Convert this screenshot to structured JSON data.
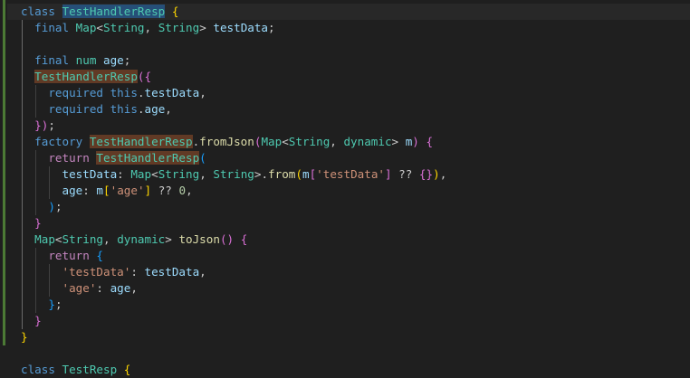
{
  "colors": {
    "background": "#1f1f1f",
    "current_line": "#282828",
    "git_gutter": "#4c7a35",
    "keyword": "#569cd6",
    "control": "#c586c0",
    "type": "#4ec9b0",
    "function": "#dcdcaa",
    "string": "#ce9178",
    "number": "#b5cea8",
    "variable": "#9cdcfe",
    "plain": "#cccccc",
    "brace_1": "#ffd700",
    "brace_2": "#da70d6",
    "brace_3": "#179fff",
    "match_highlight": "#613a25",
    "selection": "#264f78"
  },
  "code": {
    "language": "dart",
    "lines": [
      [
        [
          "keyword",
          "class "
        ],
        [
          "sel",
          "TestHandlerResp"
        ],
        [
          "plain",
          " "
        ],
        [
          "brace1",
          "{"
        ]
      ],
      [
        [
          "plain",
          "  "
        ],
        [
          "keyword",
          "final "
        ],
        [
          "type",
          "Map"
        ],
        [
          "plain",
          "<"
        ],
        [
          "type",
          "String"
        ],
        [
          "plain",
          ", "
        ],
        [
          "type",
          "String"
        ],
        [
          "plain",
          "> "
        ],
        [
          "var",
          "testData"
        ],
        [
          "plain",
          ";"
        ]
      ],
      [],
      [
        [
          "plain",
          "  "
        ],
        [
          "keyword",
          "final "
        ],
        [
          "type",
          "num "
        ],
        [
          "var",
          "age"
        ],
        [
          "plain",
          ";"
        ]
      ],
      [
        [
          "plain",
          "  "
        ],
        [
          "match",
          "TestHandlerResp"
        ],
        [
          "brace2",
          "({"
        ]
      ],
      [
        [
          "plain",
          "    "
        ],
        [
          "keyword",
          "required "
        ],
        [
          "keyword",
          "this"
        ],
        [
          "plain",
          "."
        ],
        [
          "var",
          "testData"
        ],
        [
          "plain",
          ","
        ]
      ],
      [
        [
          "plain",
          "    "
        ],
        [
          "keyword",
          "required "
        ],
        [
          "keyword",
          "this"
        ],
        [
          "plain",
          "."
        ],
        [
          "var",
          "age"
        ],
        [
          "plain",
          ","
        ]
      ],
      [
        [
          "plain",
          "  "
        ],
        [
          "brace2",
          "})"
        ],
        [
          "plain",
          ";"
        ]
      ],
      [
        [
          "plain",
          "  "
        ],
        [
          "keyword",
          "factory "
        ],
        [
          "match",
          "TestHandlerResp"
        ],
        [
          "plain",
          "."
        ],
        [
          "func",
          "fromJson"
        ],
        [
          "brace2",
          "("
        ],
        [
          "type",
          "Map"
        ],
        [
          "plain",
          "<"
        ],
        [
          "type",
          "String"
        ],
        [
          "plain",
          ", "
        ],
        [
          "type",
          "dynamic"
        ],
        [
          "plain",
          "> "
        ],
        [
          "var",
          "m"
        ],
        [
          "brace2",
          ")"
        ],
        [
          "plain",
          " "
        ],
        [
          "brace2",
          "{"
        ]
      ],
      [
        [
          "plain",
          "    "
        ],
        [
          "control",
          "return "
        ],
        [
          "match",
          "TestHandlerResp"
        ],
        [
          "brace3",
          "("
        ]
      ],
      [
        [
          "plain",
          "      "
        ],
        [
          "var",
          "testData"
        ],
        [
          "plain",
          ": "
        ],
        [
          "type",
          "Map"
        ],
        [
          "plain",
          "<"
        ],
        [
          "type",
          "String"
        ],
        [
          "plain",
          ", "
        ],
        [
          "type",
          "String"
        ],
        [
          "plain",
          ">."
        ],
        [
          "func",
          "from"
        ],
        [
          "brace1",
          "("
        ],
        [
          "var",
          "m"
        ],
        [
          "brace2",
          "["
        ],
        [
          "string",
          "'testData'"
        ],
        [
          "brace2",
          "]"
        ],
        [
          "plain",
          " ?? "
        ],
        [
          "brace2",
          "{}"
        ],
        [
          "brace1",
          ")"
        ],
        [
          "plain",
          ","
        ]
      ],
      [
        [
          "plain",
          "      "
        ],
        [
          "var",
          "age"
        ],
        [
          "plain",
          ": "
        ],
        [
          "var",
          "m"
        ],
        [
          "brace1",
          "["
        ],
        [
          "string",
          "'age'"
        ],
        [
          "brace1",
          "]"
        ],
        [
          "plain",
          " ?? "
        ],
        [
          "number",
          "0"
        ],
        [
          "plain",
          ","
        ]
      ],
      [
        [
          "plain",
          "    "
        ],
        [
          "brace3",
          ")"
        ],
        [
          "plain",
          ";"
        ]
      ],
      [
        [
          "plain",
          "  "
        ],
        [
          "brace2",
          "}"
        ]
      ],
      [
        [
          "plain",
          "  "
        ],
        [
          "type",
          "Map"
        ],
        [
          "plain",
          "<"
        ],
        [
          "type",
          "String"
        ],
        [
          "plain",
          ", "
        ],
        [
          "type",
          "dynamic"
        ],
        [
          "plain",
          "> "
        ],
        [
          "func",
          "toJson"
        ],
        [
          "brace2",
          "()"
        ],
        [
          "plain",
          " "
        ],
        [
          "brace2",
          "{"
        ]
      ],
      [
        [
          "plain",
          "    "
        ],
        [
          "control",
          "return "
        ],
        [
          "brace3",
          "{"
        ]
      ],
      [
        [
          "plain",
          "      "
        ],
        [
          "string",
          "'testData'"
        ],
        [
          "plain",
          ": "
        ],
        [
          "var",
          "testData"
        ],
        [
          "plain",
          ","
        ]
      ],
      [
        [
          "plain",
          "      "
        ],
        [
          "string",
          "'age'"
        ],
        [
          "plain",
          ": "
        ],
        [
          "var",
          "age"
        ],
        [
          "plain",
          ","
        ]
      ],
      [
        [
          "plain",
          "    "
        ],
        [
          "brace3",
          "}"
        ],
        [
          "plain",
          ";"
        ]
      ],
      [
        [
          "plain",
          "  "
        ],
        [
          "brace2",
          "}"
        ]
      ],
      [
        [
          "brace1",
          "}"
        ]
      ],
      [],
      [
        [
          "keyword",
          "class "
        ],
        [
          "type",
          "TestResp"
        ],
        [
          "plain",
          " "
        ],
        [
          "brace1",
          "{"
        ]
      ]
    ]
  }
}
